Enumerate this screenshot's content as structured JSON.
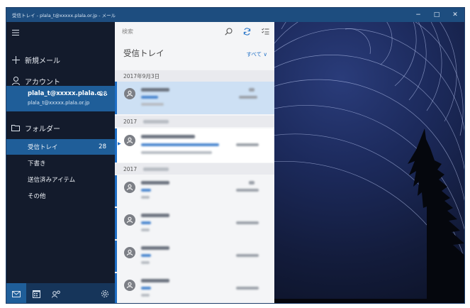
{
  "window": {
    "title": "受信トレイ - plala_t@xxxxx.plala.or.jp - メール",
    "controls": {
      "minimize": "−",
      "maximize": "□",
      "close": "✕"
    }
  },
  "sidebar": {
    "hamburger_icon": "hamburger-icon",
    "new_mail": "新規メール",
    "accounts": "アカウント",
    "account": {
      "name": "plala_t@xxxxx.plala.o...",
      "email": "plala_t@xxxxx.plala.or.jp",
      "count": "28"
    },
    "folders": "フォルダー",
    "folder_items": [
      {
        "label": "受信トレイ",
        "count": "28",
        "selected": true
      },
      {
        "label": "下書き",
        "count": "",
        "selected": false
      },
      {
        "label": "送信済みアイテム",
        "count": "",
        "selected": false
      },
      {
        "label": "その他",
        "count": "",
        "selected": false
      }
    ],
    "bottom_icons": [
      "mail-icon",
      "calendar-icon",
      "people-icon",
      "settings-icon"
    ]
  },
  "list": {
    "search_placeholder": "検索",
    "header": "受信トレイ",
    "filter": "すべて ∨",
    "groups": [
      "2017年9月3日",
      "2017",
      "2017"
    ]
  },
  "colors": {
    "accent": "#1f5e99",
    "titlebar": "#1d4d7f",
    "link": "#1f6fc6"
  }
}
